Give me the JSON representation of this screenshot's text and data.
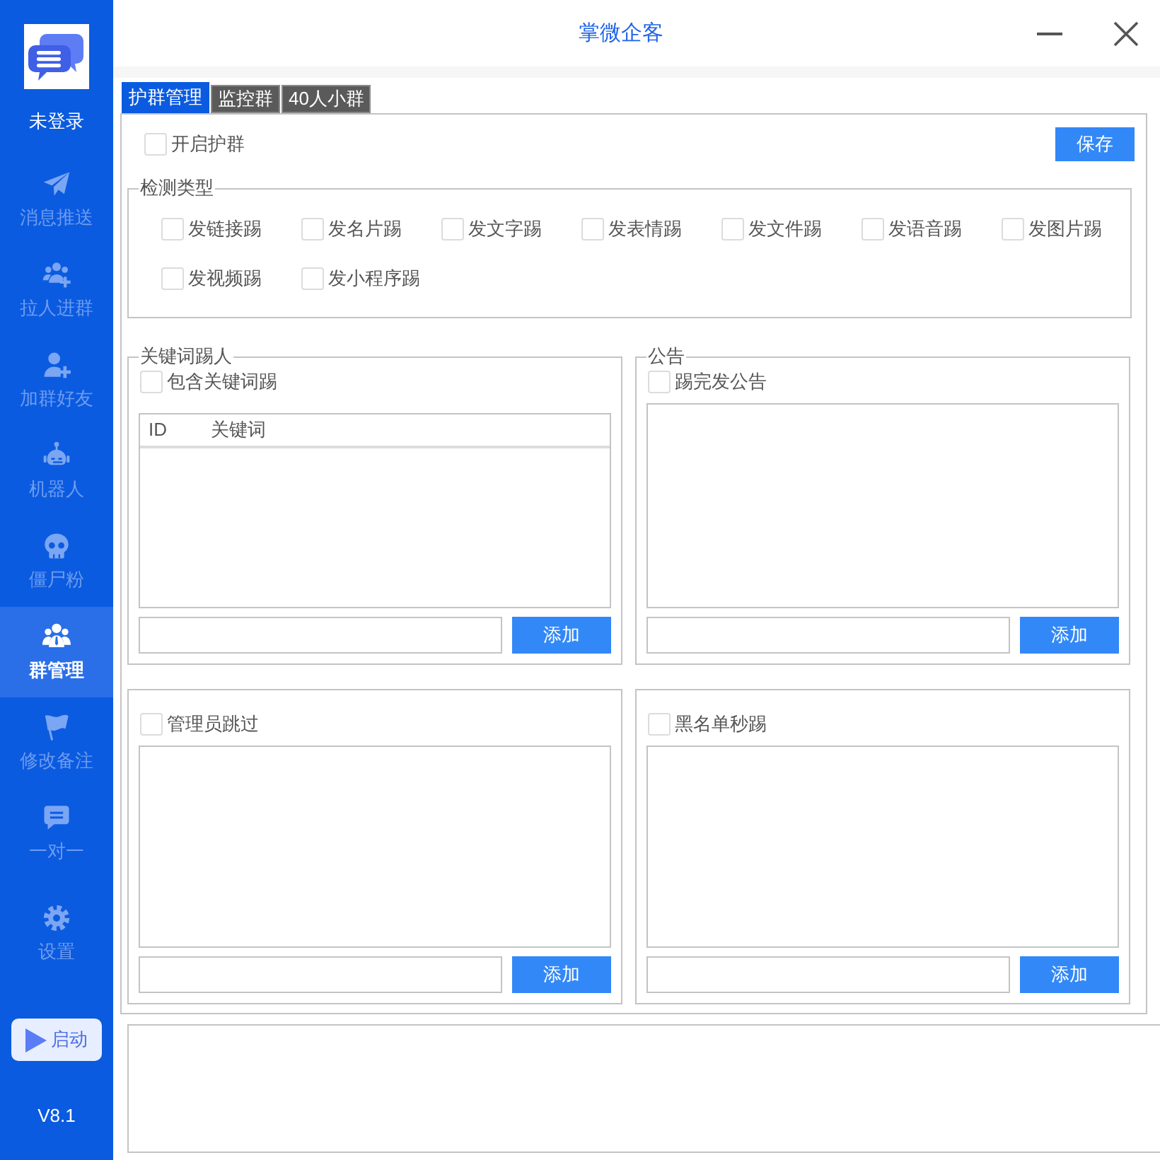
{
  "window": {
    "title": "掌微企客"
  },
  "sidebar": {
    "account": "未登录",
    "items": [
      {
        "label": "消息推送",
        "selected": false
      },
      {
        "label": "拉人进群",
        "selected": false
      },
      {
        "label": "加群好友",
        "selected": false
      },
      {
        "label": "机器人",
        "selected": false
      },
      {
        "label": "僵尸粉",
        "selected": false
      },
      {
        "label": "群管理",
        "selected": true
      },
      {
        "label": "修改备注",
        "selected": false
      },
      {
        "label": "一对一",
        "selected": false
      },
      {
        "label": "设置",
        "selected": false
      }
    ],
    "start_button": "启动",
    "version": "V8.1"
  },
  "tabs": [
    {
      "label": "护群管理",
      "selected": true
    },
    {
      "label": "监控群",
      "selected": false
    },
    {
      "label": "40人小群",
      "selected": false
    }
  ],
  "enable_option": {
    "label": "开启护群",
    "checked": false
  },
  "save_button": "保存",
  "detect_types": {
    "title": "检测类型",
    "options": [
      {
        "label": "发链接踢",
        "checked": false
      },
      {
        "label": "发名片踢",
        "checked": false
      },
      {
        "label": "发文字踢",
        "checked": false
      },
      {
        "label": "发表情踢",
        "checked": false
      },
      {
        "label": "发文件踢",
        "checked": false
      },
      {
        "label": "发语音踢",
        "checked": false
      },
      {
        "label": "发图片踢",
        "checked": false
      },
      {
        "label": "发视频踢",
        "checked": false
      },
      {
        "label": "发小程序踢",
        "checked": false
      }
    ]
  },
  "panels": [
    {
      "kind": "keyword_list",
      "title": "关键词踢人",
      "option": {
        "label": "包含关键词踢",
        "checked": false
      },
      "columns": [
        "ID",
        "关键词"
      ],
      "add_button": "添加"
    },
    {
      "kind": "text_list",
      "title": "公告",
      "option": {
        "label": "踢完发公告",
        "checked": false
      },
      "add_button": "添加"
    },
    {
      "kind": "text_list",
      "option": {
        "label": "管理员跳过",
        "checked": false
      },
      "add_button": "添加"
    },
    {
      "kind": "text_list",
      "option": {
        "label": "黑名单秒踢",
        "checked": false
      },
      "add_button": "添加"
    }
  ]
}
